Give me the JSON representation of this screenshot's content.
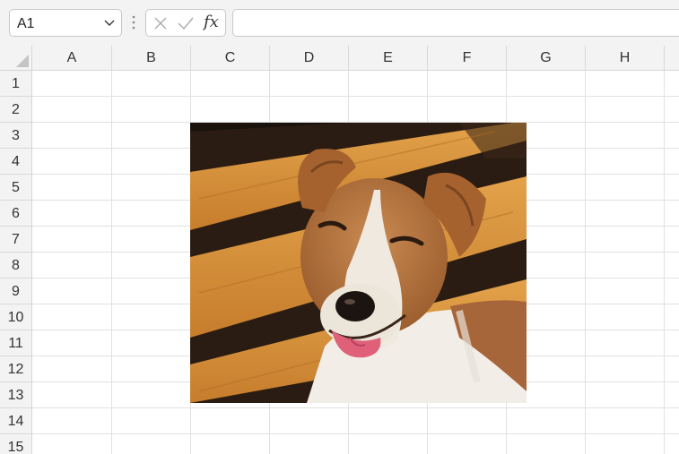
{
  "name_box": {
    "value": "A1"
  },
  "formula_bar": {
    "fx_label": "fx",
    "content": ""
  },
  "columns": [
    "A",
    "B",
    "C",
    "D",
    "E",
    "F",
    "G",
    "H"
  ],
  "rows": [
    "1",
    "2",
    "3",
    "4",
    "5",
    "6",
    "7",
    "8",
    "9",
    "10",
    "11",
    "12",
    "13",
    "14",
    "15"
  ],
  "colors": {
    "chrome": "#f3f3f3",
    "gridline": "#e1e1e1",
    "wood": "#d9923a",
    "dog_brown": "#b5743f"
  },
  "picture": {
    "subject": "dog-photo"
  }
}
